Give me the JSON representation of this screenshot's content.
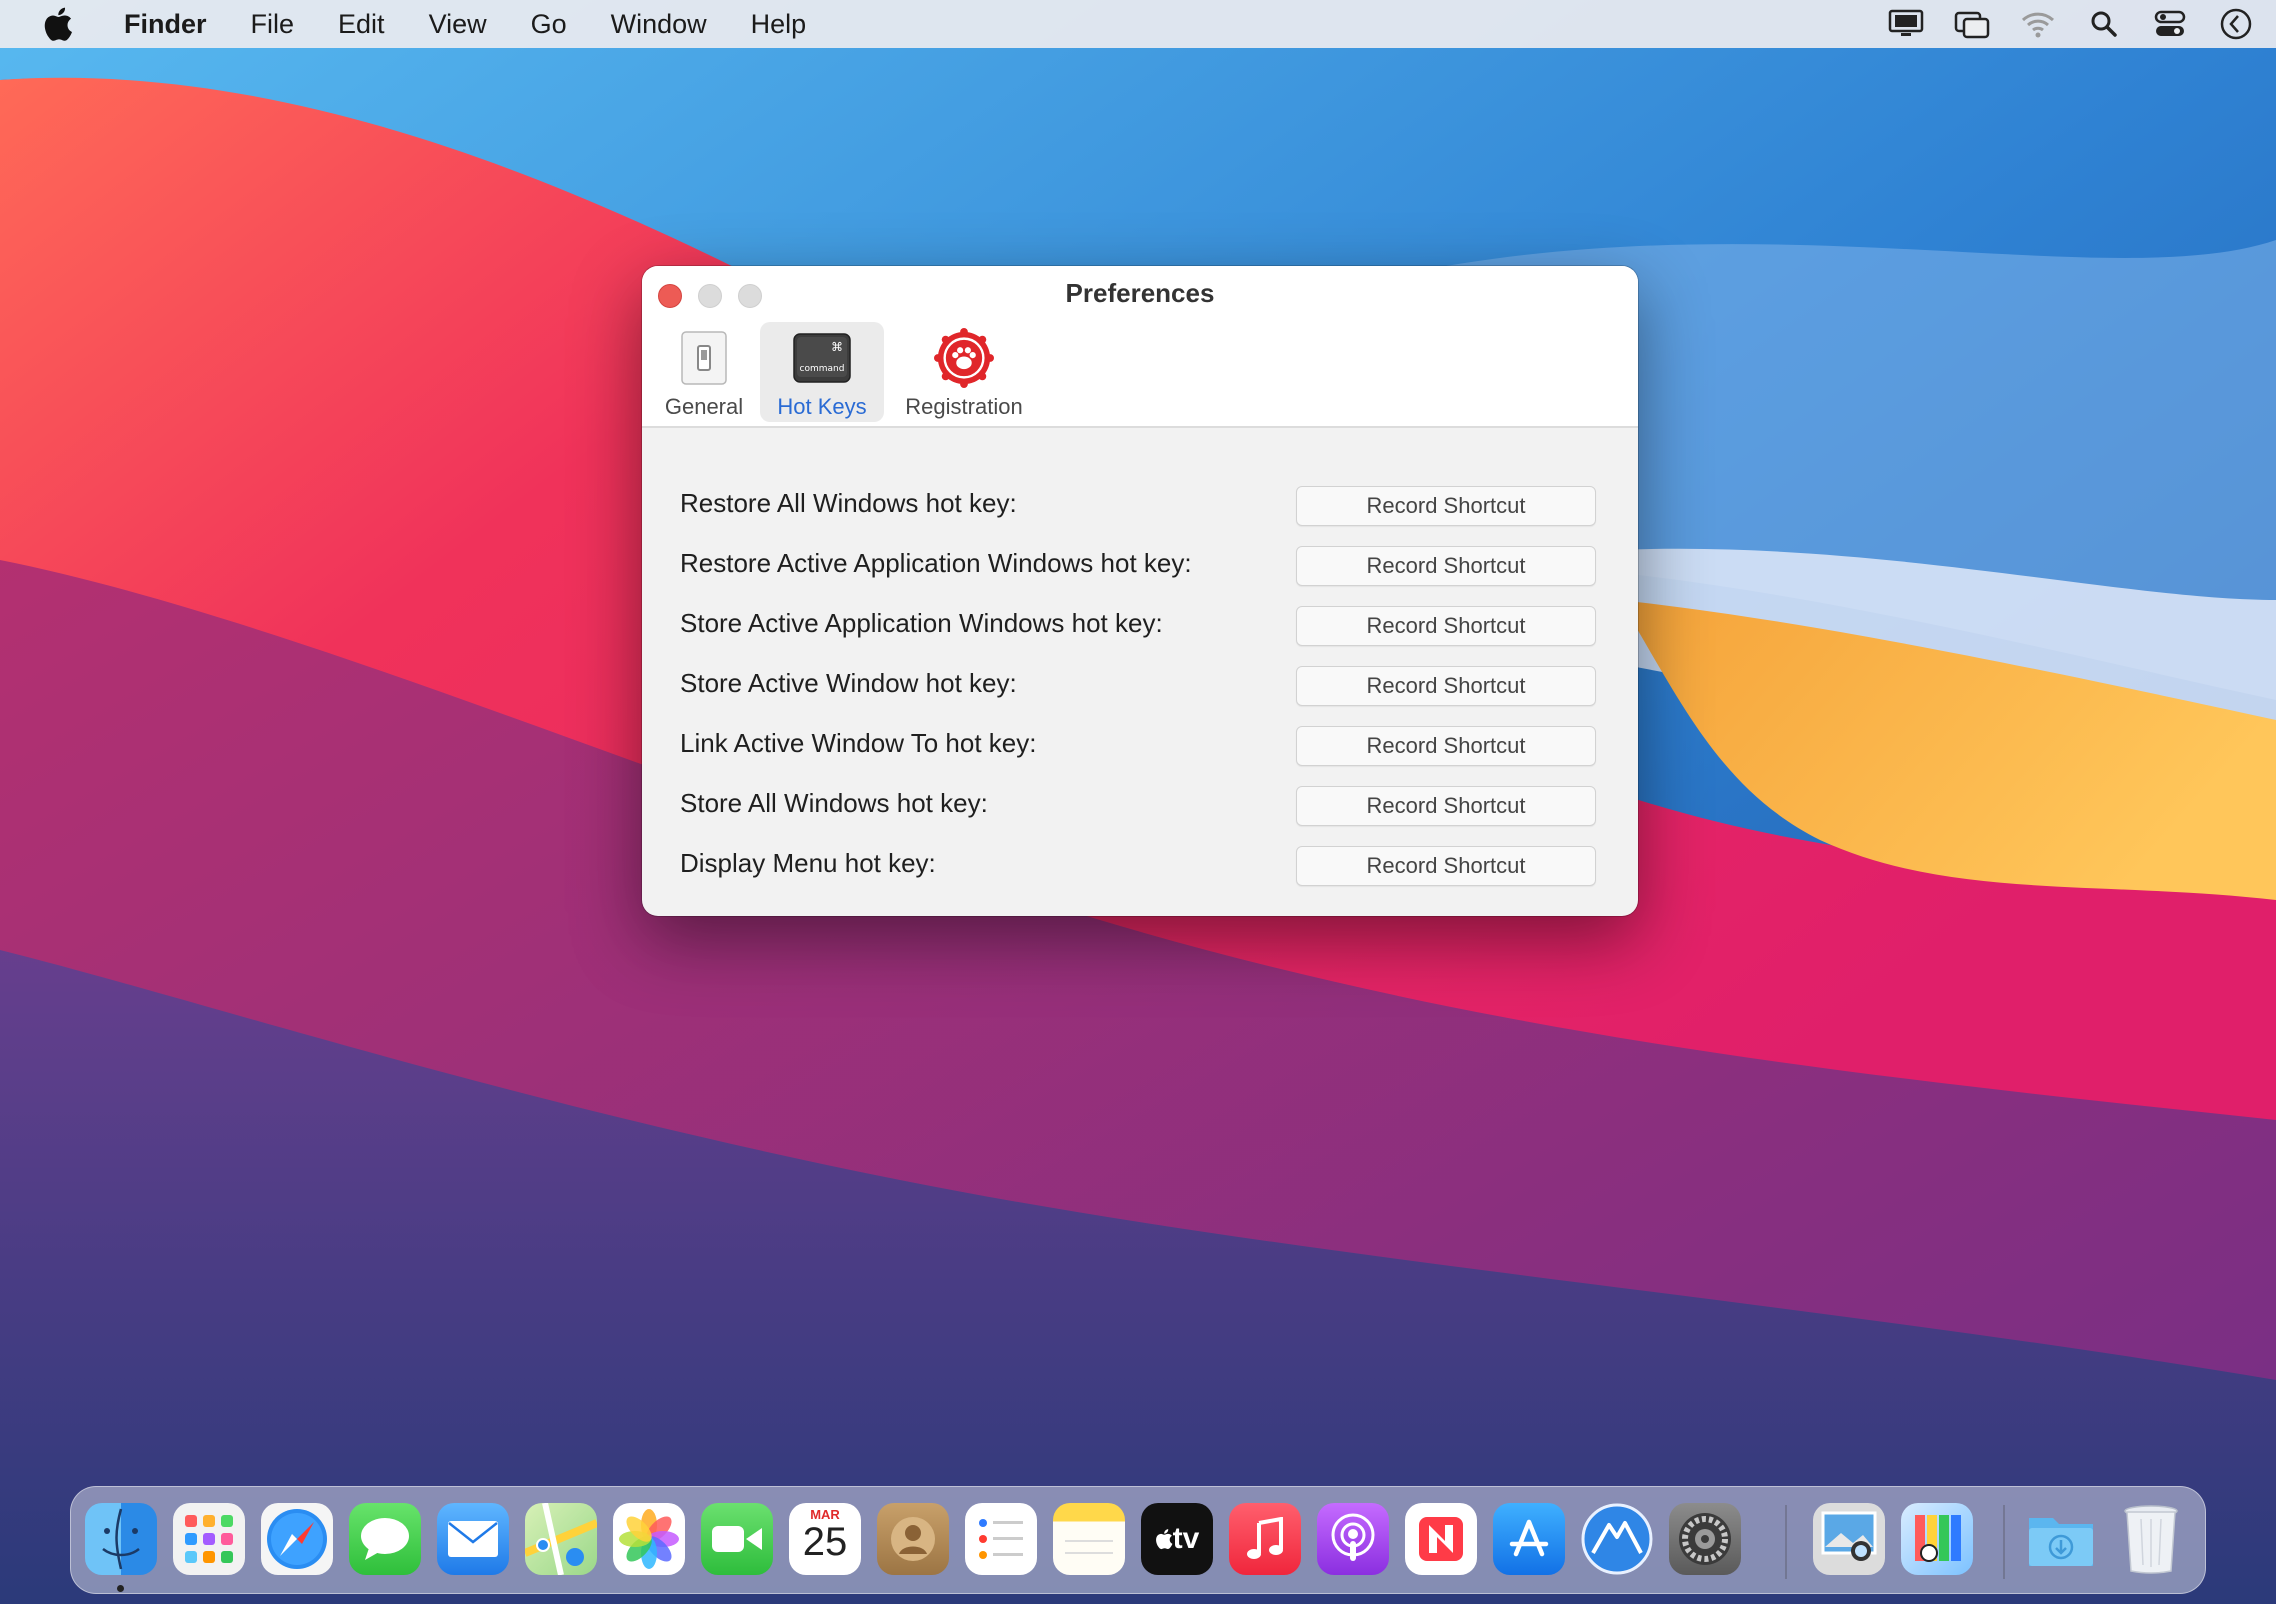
{
  "menubar": {
    "app_name": "Finder",
    "items": [
      "File",
      "Edit",
      "View",
      "Go",
      "Window",
      "Help"
    ],
    "status_icons": [
      "display-icon",
      "screen-mirroring-icon",
      "wifi-icon",
      "spotlight-search-icon",
      "control-center-icon",
      "siri-icon"
    ]
  },
  "window": {
    "title": "Preferences",
    "tabs": [
      {
        "label": "General",
        "icon": "toggle-switch-icon",
        "selected": false
      },
      {
        "label": "Hot Keys",
        "icon": "command-key-icon",
        "selected": true,
        "key_symbol": "⌘",
        "key_text": "command"
      },
      {
        "label": "Registration",
        "icon": "paw-seal-icon",
        "selected": false
      }
    ],
    "rows": [
      {
        "label": "Restore All Windows hot key:",
        "button": "Record Shortcut"
      },
      {
        "label": "Restore Active Application Windows hot key:",
        "button": "Record Shortcut"
      },
      {
        "label": "Store Active Application Windows hot key:",
        "button": "Record Shortcut"
      },
      {
        "label": "Store Active Window hot key:",
        "button": "Record Shortcut"
      },
      {
        "label": "Link Active Window To hot key:",
        "button": "Record Shortcut"
      },
      {
        "label": "Store All Windows hot key:",
        "button": "Record Shortcut"
      },
      {
        "label": "Display Menu hot key:",
        "button": "Record Shortcut"
      }
    ]
  },
  "dock": {
    "calendar": {
      "month": "MAR",
      "day": "25"
    },
    "tv_label": "tv",
    "apps": [
      "finder-icon",
      "launchpad-icon",
      "safari-icon",
      "messages-icon",
      "mail-icon",
      "maps-icon",
      "photos-icon",
      "facetime-icon",
      "calendar-icon",
      "contacts-icon",
      "reminders-icon",
      "notes-icon",
      "apple-tv-icon",
      "music-icon",
      "podcasts-icon",
      "news-icon",
      "app-store-icon",
      "mountain-app-icon",
      "system-preferences-icon",
      "preview-icon",
      "color-palette-app-icon",
      "downloads-folder-icon",
      "trash-icon"
    ]
  },
  "colors": {
    "accent": "#2a6bd4",
    "close": "#ed5b55",
    "registration_red": "#e0262a"
  }
}
